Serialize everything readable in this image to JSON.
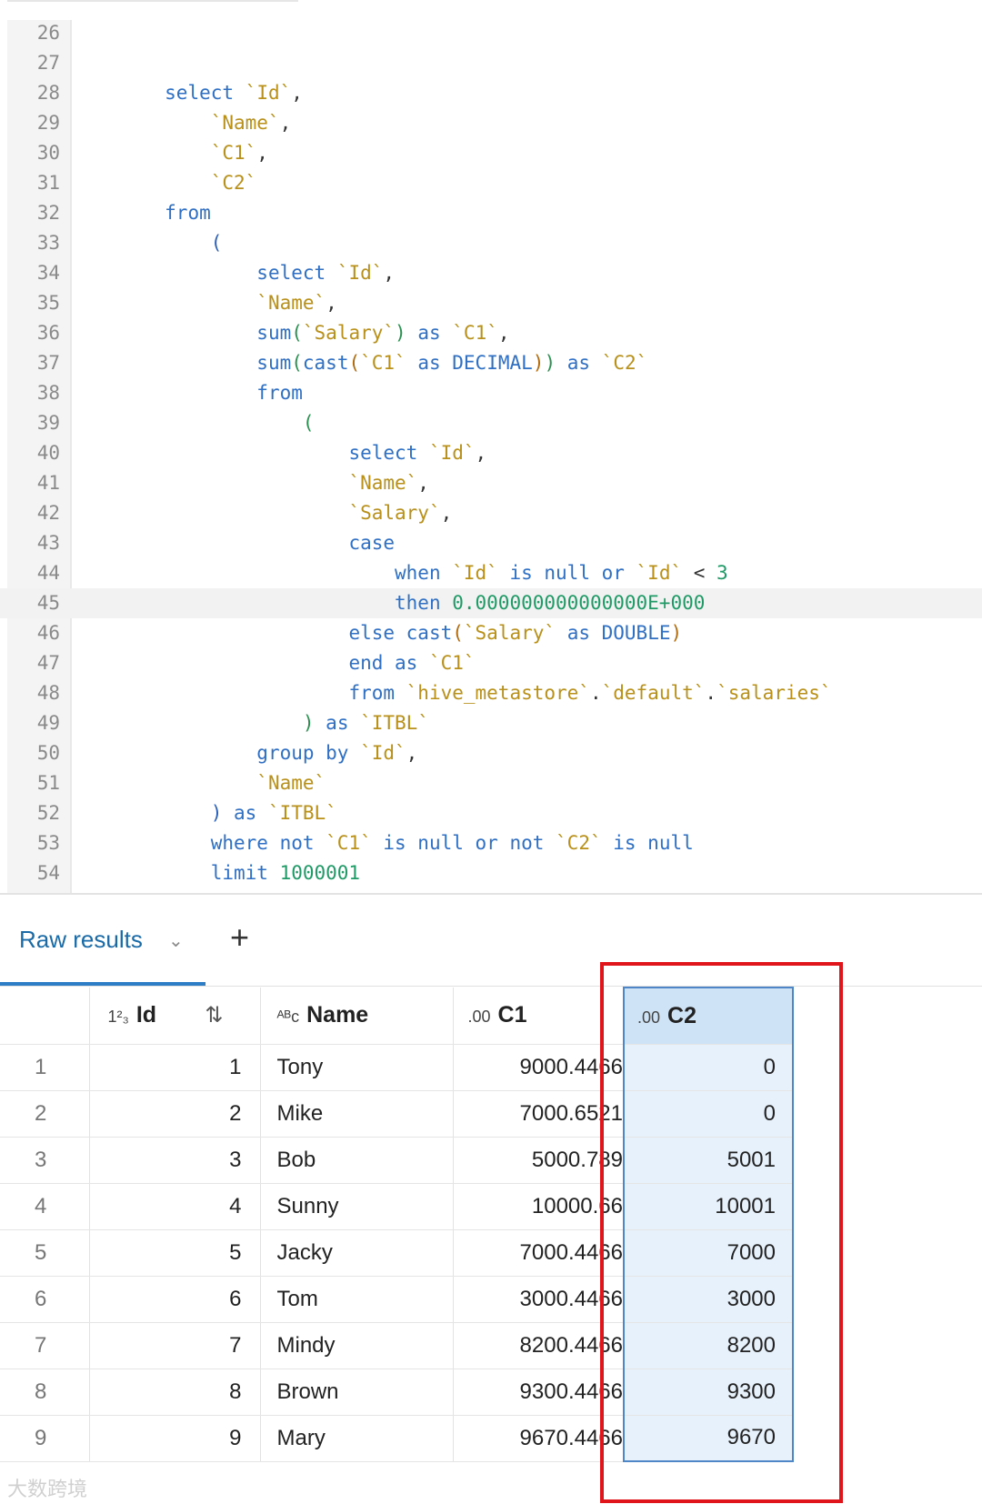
{
  "editor": {
    "lines": [
      {
        "n": "26",
        "tokens": []
      },
      {
        "n": "27",
        "tokens": []
      },
      {
        "n": "28",
        "indent": "        ",
        "tokens": [
          [
            "kw",
            "select "
          ],
          [
            "id",
            "`Id`"
          ],
          [
            "pun",
            ","
          ]
        ]
      },
      {
        "n": "29",
        "indent": "            ",
        "tokens": [
          [
            "id",
            "`Name`"
          ],
          [
            "pun",
            ","
          ]
        ]
      },
      {
        "n": "30",
        "indent": "            ",
        "tokens": [
          [
            "id",
            "`C1`"
          ],
          [
            "pun",
            ","
          ]
        ]
      },
      {
        "n": "31",
        "indent": "            ",
        "tokens": [
          [
            "id",
            "`C2`"
          ]
        ]
      },
      {
        "n": "32",
        "indent": "        ",
        "tokens": [
          [
            "kw",
            "from"
          ]
        ]
      },
      {
        "n": "33",
        "indent": "            ",
        "tokens": [
          [
            "br1",
            "("
          ]
        ]
      },
      {
        "n": "34",
        "indent": "                ",
        "tokens": [
          [
            "kw",
            "select "
          ],
          [
            "id",
            "`Id`"
          ],
          [
            "pun",
            ","
          ]
        ]
      },
      {
        "n": "35",
        "indent": "                ",
        "tokens": [
          [
            "id",
            "`Name`"
          ],
          [
            "pun",
            ","
          ]
        ]
      },
      {
        "n": "36",
        "indent": "                ",
        "tokens": [
          [
            "kw",
            "sum"
          ],
          [
            "br2",
            "("
          ],
          [
            "id",
            "`Salary`"
          ],
          [
            "br2",
            ")"
          ],
          [
            "kw",
            " as "
          ],
          [
            "id",
            "`C1`"
          ],
          [
            "pun",
            ","
          ]
        ]
      },
      {
        "n": "37",
        "indent": "                ",
        "tokens": [
          [
            "kw",
            "sum"
          ],
          [
            "br2",
            "("
          ],
          [
            "kw",
            "cast"
          ],
          [
            "br3",
            "("
          ],
          [
            "id",
            "`C1`"
          ],
          [
            "kw",
            " as DECIMAL"
          ],
          [
            "br3",
            ")"
          ],
          [
            "br2",
            ")"
          ],
          [
            "kw",
            " as "
          ],
          [
            "id",
            "`C2`"
          ]
        ]
      },
      {
        "n": "38",
        "indent": "                ",
        "tokens": [
          [
            "kw",
            "from"
          ]
        ]
      },
      {
        "n": "39",
        "indent": "                    ",
        "tokens": [
          [
            "br2",
            "("
          ]
        ]
      },
      {
        "n": "40",
        "indent": "                        ",
        "tokens": [
          [
            "kw",
            "select "
          ],
          [
            "id",
            "`Id`"
          ],
          [
            "pun",
            ","
          ]
        ]
      },
      {
        "n": "41",
        "indent": "                        ",
        "tokens": [
          [
            "id",
            "`Name`"
          ],
          [
            "pun",
            ","
          ]
        ]
      },
      {
        "n": "42",
        "indent": "                        ",
        "tokens": [
          [
            "id",
            "`Salary`"
          ],
          [
            "pun",
            ","
          ]
        ]
      },
      {
        "n": "43",
        "indent": "                        ",
        "tokens": [
          [
            "kw",
            "case"
          ]
        ]
      },
      {
        "n": "44",
        "indent": "                            ",
        "tokens": [
          [
            "kw",
            "when "
          ],
          [
            "id",
            "`Id`"
          ],
          [
            "kw",
            " is null or "
          ],
          [
            "id",
            "`Id`"
          ],
          [
            "pun",
            " < "
          ],
          [
            "num",
            "3"
          ]
        ]
      },
      {
        "n": "45",
        "indent": "                            ",
        "active": true,
        "tokens": [
          [
            "kw",
            "then "
          ],
          [
            "num",
            "0.000000000000000E+000"
          ]
        ]
      },
      {
        "n": "46",
        "indent": "                        ",
        "tokens": [
          [
            "kw",
            "else cast"
          ],
          [
            "br3",
            "("
          ],
          [
            "id",
            "`Salary`"
          ],
          [
            "kw",
            " as DOUBLE"
          ],
          [
            "br3",
            ")"
          ]
        ]
      },
      {
        "n": "47",
        "indent": "                        ",
        "tokens": [
          [
            "kw",
            "end as "
          ],
          [
            "id",
            "`C1`"
          ]
        ]
      },
      {
        "n": "48",
        "indent": "                        ",
        "tokens": [
          [
            "kw",
            "from "
          ],
          [
            "id",
            "`hive_metastore`"
          ],
          [
            "pun",
            "."
          ],
          [
            "id",
            "`default`"
          ],
          [
            "pun",
            "."
          ],
          [
            "id",
            "`salaries`"
          ]
        ]
      },
      {
        "n": "49",
        "indent": "                    ",
        "tokens": [
          [
            "br2",
            ")"
          ],
          [
            "kw",
            " as "
          ],
          [
            "id",
            "`ITBL`"
          ]
        ]
      },
      {
        "n": "50",
        "indent": "                ",
        "tokens": [
          [
            "kw",
            "group by "
          ],
          [
            "id",
            "`Id`"
          ],
          [
            "pun",
            ","
          ]
        ]
      },
      {
        "n": "51",
        "indent": "                ",
        "tokens": [
          [
            "id",
            "`Name`"
          ]
        ]
      },
      {
        "n": "52",
        "indent": "            ",
        "tokens": [
          [
            "br1",
            ")"
          ],
          [
            "kw",
            " as "
          ],
          [
            "id",
            "`ITBL`"
          ]
        ]
      },
      {
        "n": "53",
        "indent": "            ",
        "tokens": [
          [
            "kw",
            "where not "
          ],
          [
            "id",
            "`C1`"
          ],
          [
            "kw",
            " is null or not "
          ],
          [
            "id",
            "`C2`"
          ],
          [
            "kw",
            " is null"
          ]
        ]
      },
      {
        "n": "54",
        "indent": "            ",
        "tokens": [
          [
            "kw",
            "limit "
          ],
          [
            "num",
            "1000001"
          ]
        ]
      }
    ]
  },
  "results": {
    "tab_label": "Raw results",
    "add_label": "+",
    "columns": [
      {
        "type_icon": "1²₃",
        "name": "Id"
      },
      {
        "type_icon": "ᴬᴮc",
        "name": "Name"
      },
      {
        "type_icon": ".00",
        "name": "C1"
      },
      {
        "type_icon": ".00",
        "name": "C2"
      }
    ],
    "rows": [
      {
        "row": "1",
        "id": "1",
        "name": "Tony",
        "c1": "9000.4466",
        "c2": "0"
      },
      {
        "row": "2",
        "id": "2",
        "name": "Mike",
        "c1": "7000.6521",
        "c2": "0"
      },
      {
        "row": "3",
        "id": "3",
        "name": "Bob",
        "c1": "5000.789",
        "c2": "5001"
      },
      {
        "row": "4",
        "id": "4",
        "name": "Sunny",
        "c1": "10000.66",
        "c2": "10001"
      },
      {
        "row": "5",
        "id": "5",
        "name": "Jacky",
        "c1": "7000.4466",
        "c2": "7000"
      },
      {
        "row": "6",
        "id": "6",
        "name": "Tom",
        "c1": "3000.4466",
        "c2": "3000"
      },
      {
        "row": "7",
        "id": "7",
        "name": "Mindy",
        "c1": "8200.4466",
        "c2": "8200"
      },
      {
        "row": "8",
        "id": "8",
        "name": "Brown",
        "c1": "9300.4466",
        "c2": "9300"
      },
      {
        "row": "9",
        "id": "9",
        "name": "Mary",
        "c1": "9670.4466",
        "c2": "9670"
      }
    ]
  },
  "watermark": "大数跨境"
}
